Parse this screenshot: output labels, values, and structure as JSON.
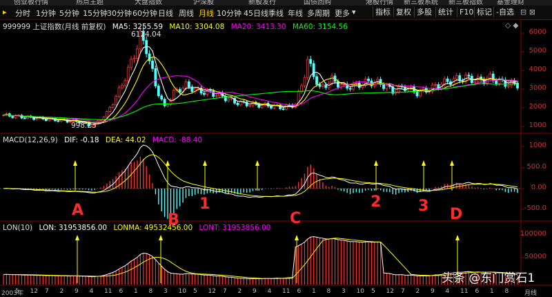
{
  "top_strip": [
    "创业板行情",
    "热点主题",
    "大盘指数",
    "沪深股",
    "新股发行",
    "国债回购",
    "港股行情",
    "新三板系统",
    "新三板指数",
    "基金理财"
  ],
  "toolbar": {
    "periods": [
      "分时",
      "1分钟",
      "5分钟",
      "15分钟",
      "30分钟",
      "60分钟",
      "日线",
      "周线",
      "月线",
      "10分钟",
      "45日线",
      "季线",
      "年线",
      "多周期",
      "更多"
    ],
    "active_period": "月线",
    "right_buttons": [
      "指标",
      "复权",
      "多股",
      "统计",
      "F10",
      "标记",
      "-自选"
    ]
  },
  "main_panel": {
    "title": "999999 上证指数(月线 前复权)",
    "ma5": "MA5: 3255.59",
    "ma10": "MA10: 3304.08",
    "ma20": "MA20: 3413.30",
    "ma60": "MA60: 3154.56",
    "high_label": "6124.04",
    "low_label": "998.23",
    "yticks": [
      "6000",
      "5000",
      "4000",
      "3000",
      "2000",
      "1000"
    ]
  },
  "macd_panel": {
    "title": "MACD(12,26,9)",
    "dif": "DIF: -0.18",
    "dea": "DEA: 44.02",
    "macd": "MACD: -88.40",
    "yticks": [
      "1000",
      "500.0",
      "0.00",
      "-500.0"
    ]
  },
  "lon_panel": {
    "title": "LON(10)",
    "lon": "LON: 31953856.00",
    "lonma": "LONMA: 49532456.00",
    "lont": "LONT: 31953856.00",
    "yticks": [
      "100000",
      "50000"
    ]
  },
  "markers": [
    "A",
    "1",
    "B",
    "C",
    "2",
    "3",
    "D"
  ],
  "x_axis": [
    "2003年",
    "5",
    "12",
    "7",
    "2",
    "9",
    "4",
    "11",
    "6",
    "1",
    "8",
    "3",
    "10",
    "5",
    "12",
    "7",
    "2",
    "9",
    "4",
    "11",
    "6",
    "1",
    "8",
    "3",
    "10",
    "5",
    "12",
    "7",
    "2",
    "9",
    "4",
    "11",
    "6",
    "1",
    "8",
    "月线"
  ],
  "watermark": "头条 @东门赏石1",
  "colors": {
    "up": "#ff3232",
    "down": "#54ffff",
    "ma5": "#ffffff",
    "ma10": "#ffff00",
    "ma20": "#ff00ff",
    "ma60": "#00ff00",
    "axis": "#cc3333"
  }
}
